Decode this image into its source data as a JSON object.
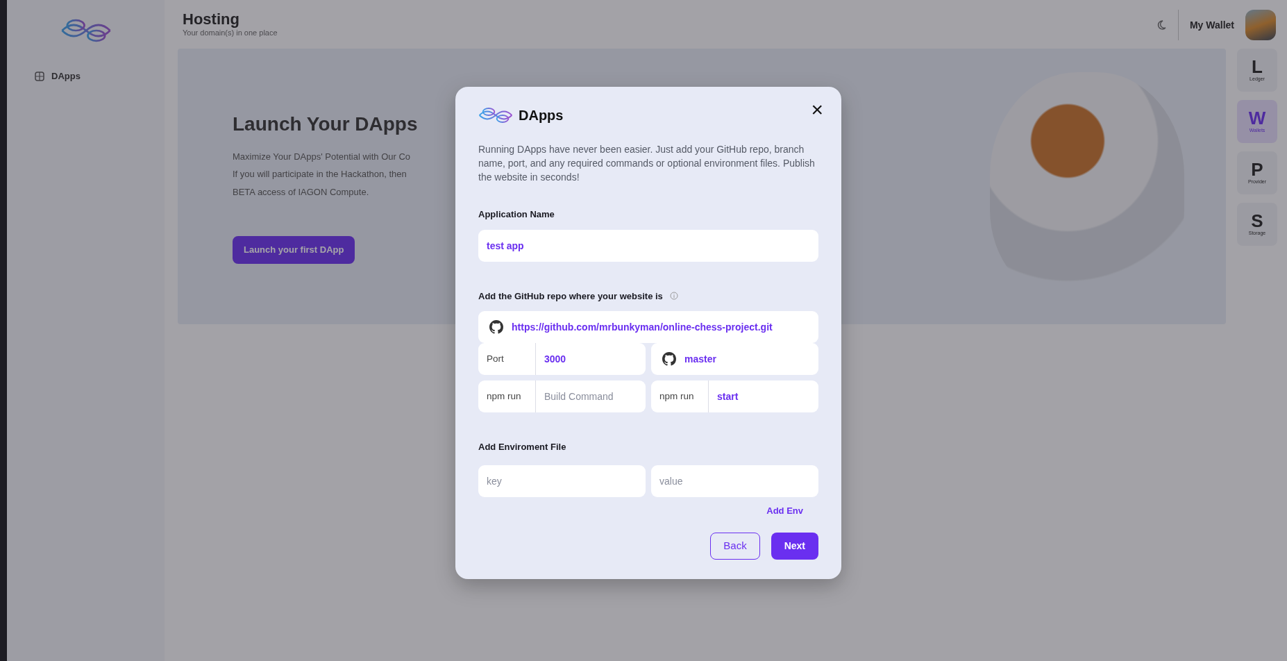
{
  "sidebar": {
    "items": [
      {
        "label": "DApps"
      }
    ]
  },
  "header": {
    "title": "Hosting",
    "subtitle": "Your domain(s) in one place",
    "wallet_label": "My Wallet"
  },
  "hero": {
    "title": "Launch Your DApps",
    "lines": [
      "Maximize Your DApps' Potential with Our Co",
      "If you will participate in the Hackathon, then",
      "BETA access of IAGON Compute."
    ],
    "button": "Launch your first DApp"
  },
  "rail": [
    {
      "letter": "L",
      "label": "Ledger",
      "selected": false
    },
    {
      "letter": "W",
      "label": "Wallets",
      "selected": true
    },
    {
      "letter": "P",
      "label": "Provider",
      "selected": false
    },
    {
      "letter": "S",
      "label": "Storage",
      "selected": false
    }
  ],
  "modal": {
    "title": "DApps",
    "close": "×",
    "description": "Running DApps have never been easier. Just add your GitHub repo, branch name, port, and any required commands or optional environment files. Publish the website in seconds!",
    "app_name": {
      "label": "Application Name",
      "value": "test app"
    },
    "repo": {
      "label": "Add the GitHub repo where your website is",
      "value": "https://github.com/mrbunkyman/online-chess-project.git"
    },
    "fields": [
      {
        "kind": "addon",
        "addon": "Port",
        "value": "3000"
      },
      {
        "kind": "github",
        "value": "master"
      },
      {
        "kind": "addon",
        "addon": "npm run",
        "placeholder": "Build Command"
      },
      {
        "kind": "addon",
        "addon": "npm run",
        "value": "start"
      }
    ],
    "env": {
      "label": "Add Enviroment File",
      "key_placeholder": "key",
      "value_placeholder": "value",
      "add": "Add Env"
    },
    "buttons": [
      {
        "kind": "outline",
        "label": "Back"
      },
      {
        "kind": "primary",
        "label": "Next"
      }
    ]
  }
}
